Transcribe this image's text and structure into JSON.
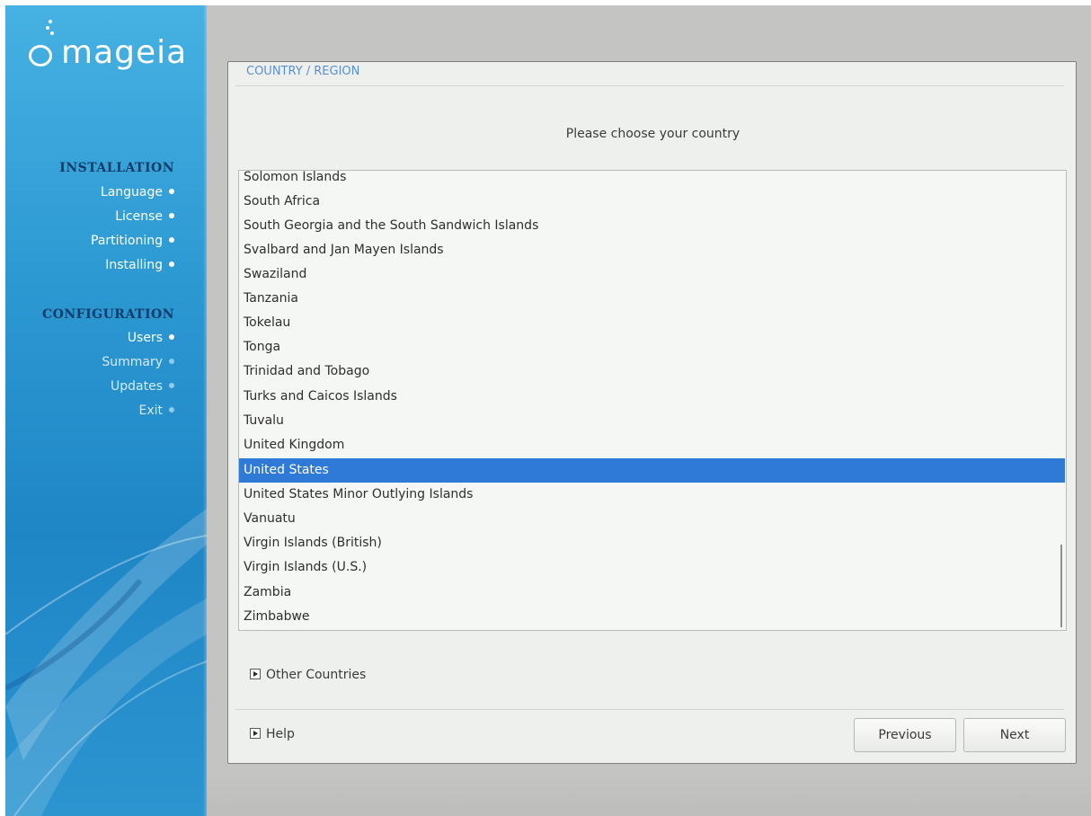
{
  "brand": {
    "name": "mageia"
  },
  "sidebar": {
    "sections": [
      {
        "title": "INSTALLATION",
        "steps": [
          {
            "label": "Language",
            "state": "done"
          },
          {
            "label": "License",
            "state": "done"
          },
          {
            "label": "Partitioning",
            "state": "done"
          },
          {
            "label": "Installing",
            "state": "done"
          }
        ]
      },
      {
        "title": "CONFIGURATION",
        "steps": [
          {
            "label": "Users",
            "state": "done"
          },
          {
            "label": "Summary",
            "state": "pending"
          },
          {
            "label": "Updates",
            "state": "pending"
          },
          {
            "label": "Exit",
            "state": "pending"
          }
        ]
      }
    ]
  },
  "dialog": {
    "title": "COUNTRY / REGION",
    "prompt": "Please choose your country",
    "countries": [
      "Solomon Islands",
      "South Africa",
      "South Georgia and the South Sandwich Islands",
      "Svalbard and Jan Mayen Islands",
      "Swaziland",
      "Tanzania",
      "Tokelau",
      "Tonga",
      "Trinidad and Tobago",
      "Turks and Caicos Islands",
      "Tuvalu",
      "United Kingdom",
      "United States",
      "United States Minor Outlying Islands",
      "Vanuatu",
      "Virgin Islands (British)",
      "Virgin Islands (U.S.)",
      "Zambia",
      "Zimbabwe"
    ],
    "selected_country": "United States",
    "other_countries_label": "Other Countries",
    "help_label": "Help",
    "previous_label": "Previous",
    "next_label": "Next"
  },
  "colors": {
    "sidebar_blue": "#2c98d2",
    "section_title": "#103c68",
    "selection": "#2f7ad6",
    "dialog_title": "#5b8fd0"
  }
}
